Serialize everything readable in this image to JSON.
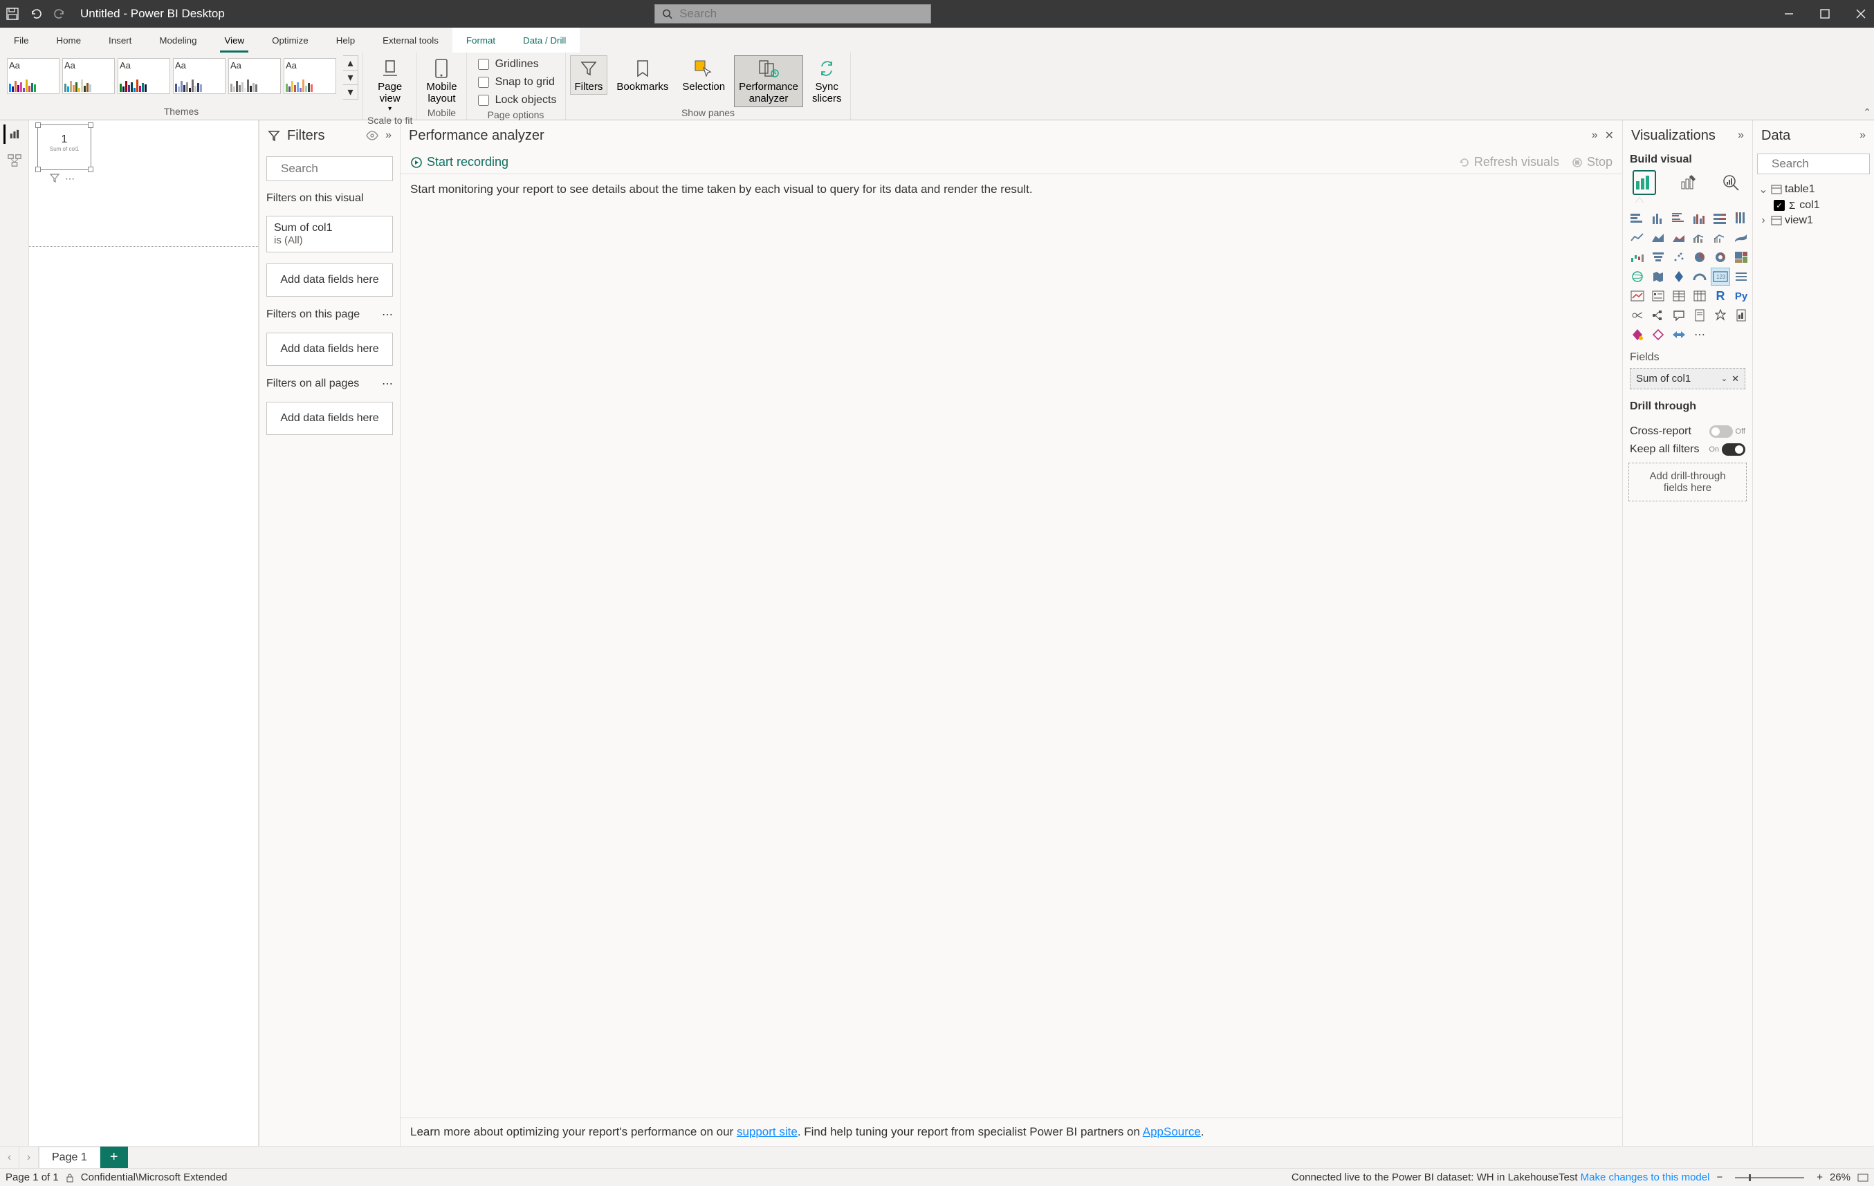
{
  "titlebar": {
    "title": "Untitled - Power BI Desktop",
    "search_placeholder": "Search"
  },
  "tabs": {
    "file": "File",
    "home": "Home",
    "insert": "Insert",
    "modeling": "Modeling",
    "view": "View",
    "optimize": "Optimize",
    "help": "Help",
    "external": "External tools",
    "format": "Format",
    "datadrill": "Data / Drill"
  },
  "ribbon": {
    "themes_label": "Themes",
    "scale_label": "Scale to fit",
    "mobile_label": "Mobile",
    "pageoptions_label": "Page options",
    "showpanes_label": "Show panes",
    "page_view": "Page\nview",
    "mobile_layout": "Mobile\nlayout",
    "gridlines": "Gridlines",
    "snap": "Snap to grid",
    "lock": "Lock objects",
    "filters": "Filters",
    "bookmarks": "Bookmarks",
    "selection": "Selection",
    "perf": "Performance\nanalyzer",
    "sync": "Sync\nslicers"
  },
  "canvas": {
    "card_value": "1",
    "card_label": "Sum of col1"
  },
  "filters": {
    "title": "Filters",
    "search": "Search",
    "on_visual": "Filters on this visual",
    "card_title": "Sum of col1",
    "card_sub": "is (All)",
    "drop": "Add data fields here",
    "on_page": "Filters on this page",
    "on_all": "Filters on all pages"
  },
  "perf": {
    "title": "Performance analyzer",
    "start": "Start recording",
    "refresh": "Refresh visuals",
    "stop": "Stop",
    "msg": "Start monitoring your report to see details about the time taken by each visual to query for its data and render the result.",
    "footer1": "Learn more about optimizing your report's performance on our ",
    "support": "support site",
    "footer2": ". Find help tuning your report from specialist Power BI partners on ",
    "appsource": "AppSource",
    "footer3": "."
  },
  "viz": {
    "title": "Visualizations",
    "build": "Build visual",
    "fields": "Fields",
    "field_value": "Sum of col1",
    "drill": "Drill through",
    "cross": "Cross-report",
    "cross_state": "Off",
    "keep": "Keep all filters",
    "keep_state": "On",
    "drillzone": "Add drill-through fields here"
  },
  "data": {
    "title": "Data",
    "search": "Search",
    "table": "table1",
    "col": "col1",
    "view": "view1"
  },
  "pagetabs": {
    "page1": "Page 1"
  },
  "status": {
    "page": "Page 1 of 1",
    "sensitivity": "Confidential\\Microsoft Extended",
    "conn": "Connected live to the Power BI dataset: WH in LakehouseTest ",
    "changes": "Make changes to this model",
    "zoom": "26%"
  }
}
